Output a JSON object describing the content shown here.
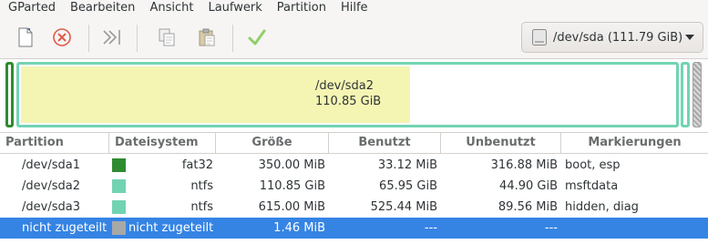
{
  "menubar": {
    "items": [
      "GParted",
      "Bearbeiten",
      "Ansicht",
      "Laufwerk",
      "Partition",
      "Hilfe"
    ]
  },
  "toolbar": {
    "buttons": [
      {
        "icon": "new-partition-icon"
      },
      {
        "icon": "delete-icon"
      },
      {
        "icon": "resize-move-icon"
      },
      {
        "icon": "copy-icon"
      },
      {
        "icon": "paste-icon"
      },
      {
        "icon": "apply-icon"
      }
    ],
    "device_label": "/dev/sda (111.79 GiB)"
  },
  "map": {
    "label_name": "/dev/sda2",
    "label_size": "110.85 GiB",
    "sda2_used_fraction": 0.595
  },
  "table": {
    "headers": [
      "Partition",
      "Dateisystem",
      "Größe",
      "Benutzt",
      "Unbenutzt",
      "Markierungen"
    ],
    "rows": [
      {
        "partition": "/dev/sda1",
        "color": "#2f8b2f",
        "fs": "fat32",
        "size": "350.00 MiB",
        "used": "33.12 MiB",
        "unused": "316.88 MiB",
        "flags": "boot, esp"
      },
      {
        "partition": "/dev/sda2",
        "color": "#72d3b3",
        "fs": "ntfs",
        "size": "110.85 GiB",
        "used": "65.95 GiB",
        "unused": "44.90 GiB",
        "flags": "msftdata"
      },
      {
        "partition": "/dev/sda3",
        "color": "#72d3b3",
        "fs": "ntfs",
        "size": "615.00 MiB",
        "used": "525.44 MiB",
        "unused": "89.56 MiB",
        "flags": "hidden, diag"
      },
      {
        "partition": "nicht zugeteilt",
        "color": "#a8a8a8",
        "fs": "nicht zugeteilt",
        "size": "1.46 MiB",
        "used": "---",
        "unused": "---",
        "flags": ""
      }
    ]
  },
  "colors": {
    "selection": "#3584e4",
    "used_space": "#f5f5b3"
  }
}
